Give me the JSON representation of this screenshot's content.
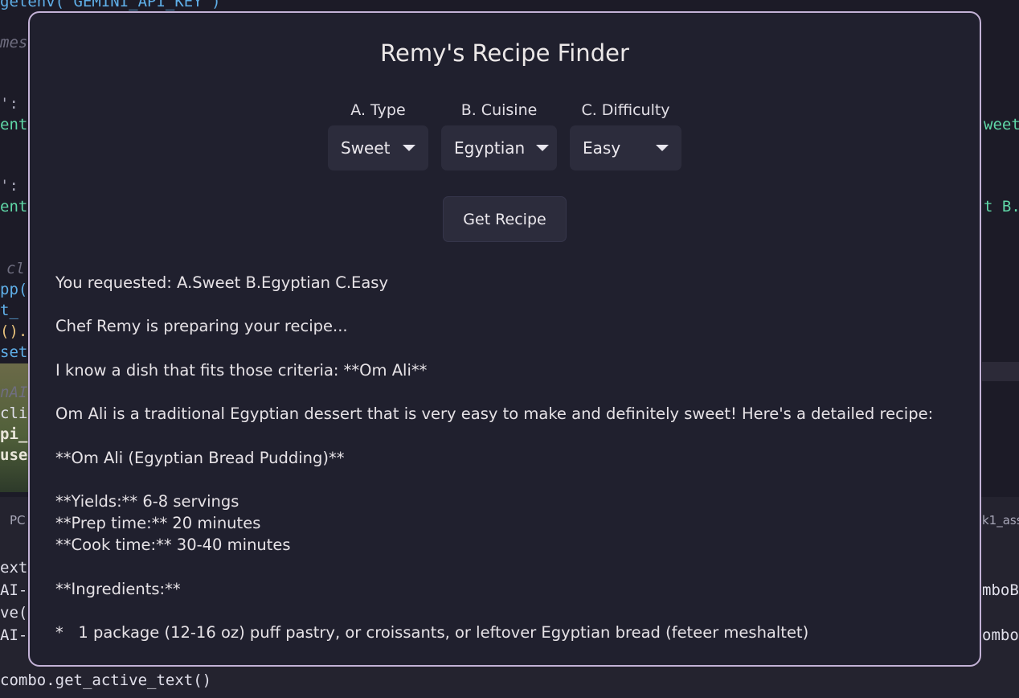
{
  "editor_background": {
    "top_fragment": "getenv(\"GEMINI_API_KEY\")",
    "left_lines": [
      "mes",
      "':",
      "ent",
      "':",
      "ent",
      "cl",
      "pp(",
      "t_",
      "().",
      "set",
      "nAI",
      "clie",
      "pi_",
      "use",
      "PC",
      "ext",
      "AI-",
      "ve(",
      "AI-"
    ],
    "right_lines": [
      "weet",
      "t B.",
      "k1_ass",
      "mboB",
      "ombo"
    ],
    "bottom_line": "combo.get_active_text()"
  },
  "dialog": {
    "title": "Remy's Recipe Finder",
    "combos": [
      {
        "label": "A. Type",
        "value": "Sweet"
      },
      {
        "label": "B. Cuisine",
        "value": "Egyptian"
      },
      {
        "label": "C. Difficulty",
        "value": "Easy"
      }
    ],
    "button_label": "Get Recipe",
    "output_lines": [
      "You requested: A.Sweet B.Egyptian C.Easy",
      "",
      "Chef Remy is preparing your recipe...",
      "",
      "I know a dish that fits those criteria: **Om Ali**",
      "",
      "Om Ali is a traditional Egyptian dessert that is very easy to make and definitely sweet! Here's a detailed recipe:",
      "",
      "**Om Ali (Egyptian Bread Pudding)**",
      "",
      "**Yields:** 6-8 servings",
      "**Prep time:** 20 minutes",
      "**Cook time:** 30-40 minutes",
      "",
      "**Ingredients:**",
      "",
      "*   1 package (12-16 oz) puff pastry, or croissants, or leftover Egyptian bread (feteer meshaltet)"
    ]
  }
}
